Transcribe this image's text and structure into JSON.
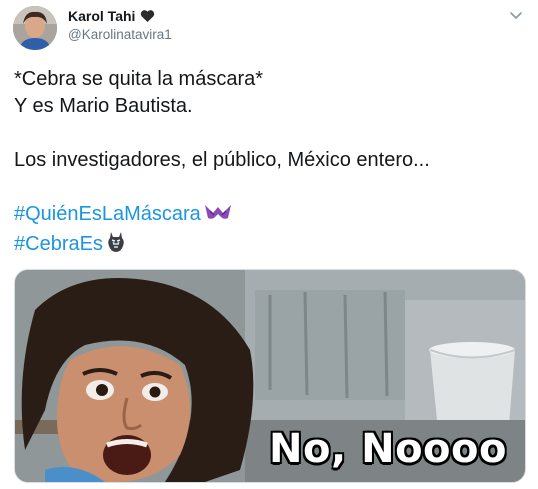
{
  "author": {
    "display_name": "Karol Tahi",
    "handle": "@Karolinatavira1"
  },
  "icons": {
    "heart": "black-heart-icon",
    "menu": "chevron-down-icon",
    "emoji_mask": "purple-mask-emoji",
    "emoji_zebra": "zebra-emoji"
  },
  "tweet": {
    "line1": "*Cebra se quita la máscara*",
    "line2": "Y es Mario Bautista.",
    "line3": "Los investigadores, el público, México entero...",
    "hashtag1": "#QuiénEsLaMáscara",
    "hashtag2": "#CebraEs"
  },
  "media": {
    "caption": "No, Noooo"
  },
  "colors": {
    "hashtag": "#1b95e0",
    "text": "#14171a",
    "secondary": "#657786",
    "mask_emoji": "#8a4bb8"
  }
}
